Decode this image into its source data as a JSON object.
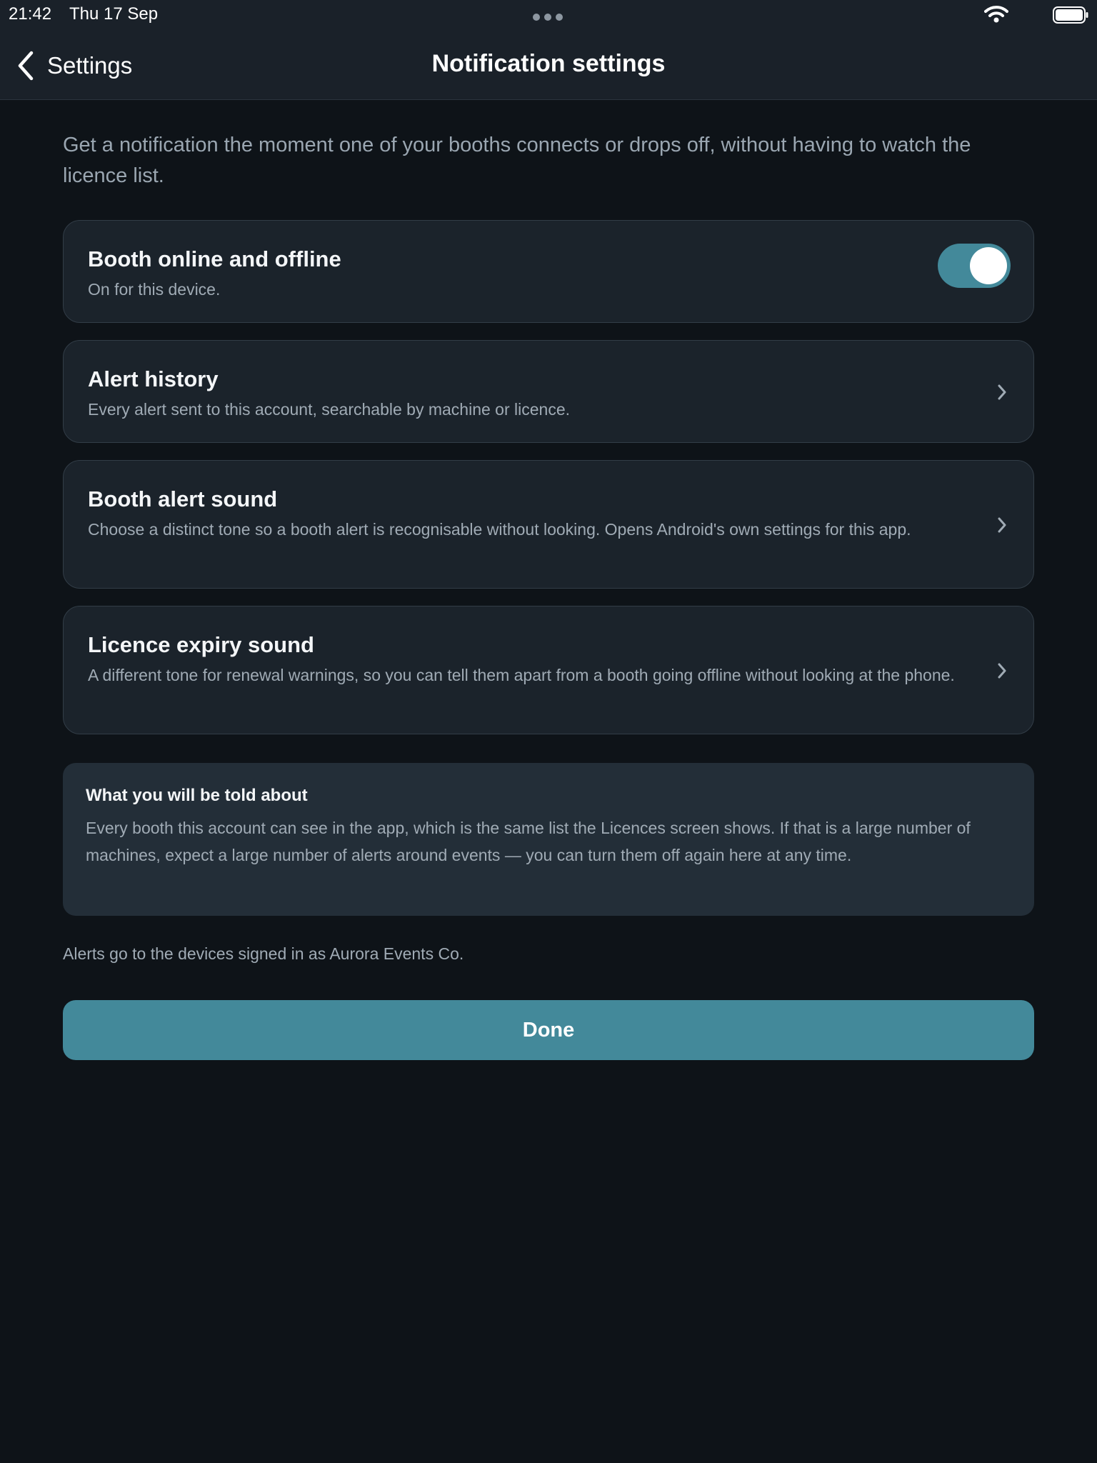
{
  "status_bar": {
    "time": "21:42",
    "date": "Thu 17 Sep"
  },
  "nav": {
    "back_label": "Settings",
    "title": "Notification settings"
  },
  "intro": "Get a notification the moment one of your booths connects or drops off, without having to watch the licence list.",
  "cards": [
    {
      "title": "Booth online and offline",
      "description": "On for this device.",
      "control": "toggle",
      "toggle_on": true
    },
    {
      "title": "Alert history",
      "description": "Every alert sent to this account, searchable by machine or licence.",
      "control": "chevron"
    },
    {
      "title": "Booth alert sound",
      "description": "Choose a distinct tone so a booth alert is recognisable without looking. Opens Android's own settings for this app.",
      "control": "chevron"
    },
    {
      "title": "Licence expiry sound",
      "description": "A different tone for renewal warnings, so you can tell them apart from a booth going offline without looking at the phone.",
      "control": "chevron"
    }
  ],
  "info": {
    "title": "What you will be told about",
    "text": "Every booth this account can see in the app, which is the same list the Licences screen shows. If that is a large number of machines, expect a large number of alerts around events — you can turn them off again here at any time."
  },
  "footnote": "Alerts go to the devices signed in as Aurora Events Co.",
  "done_label": "Done",
  "colors": {
    "accent": "#43899a",
    "background": "#0e1318",
    "card": "#1b232b",
    "info_box": "#232e38"
  }
}
